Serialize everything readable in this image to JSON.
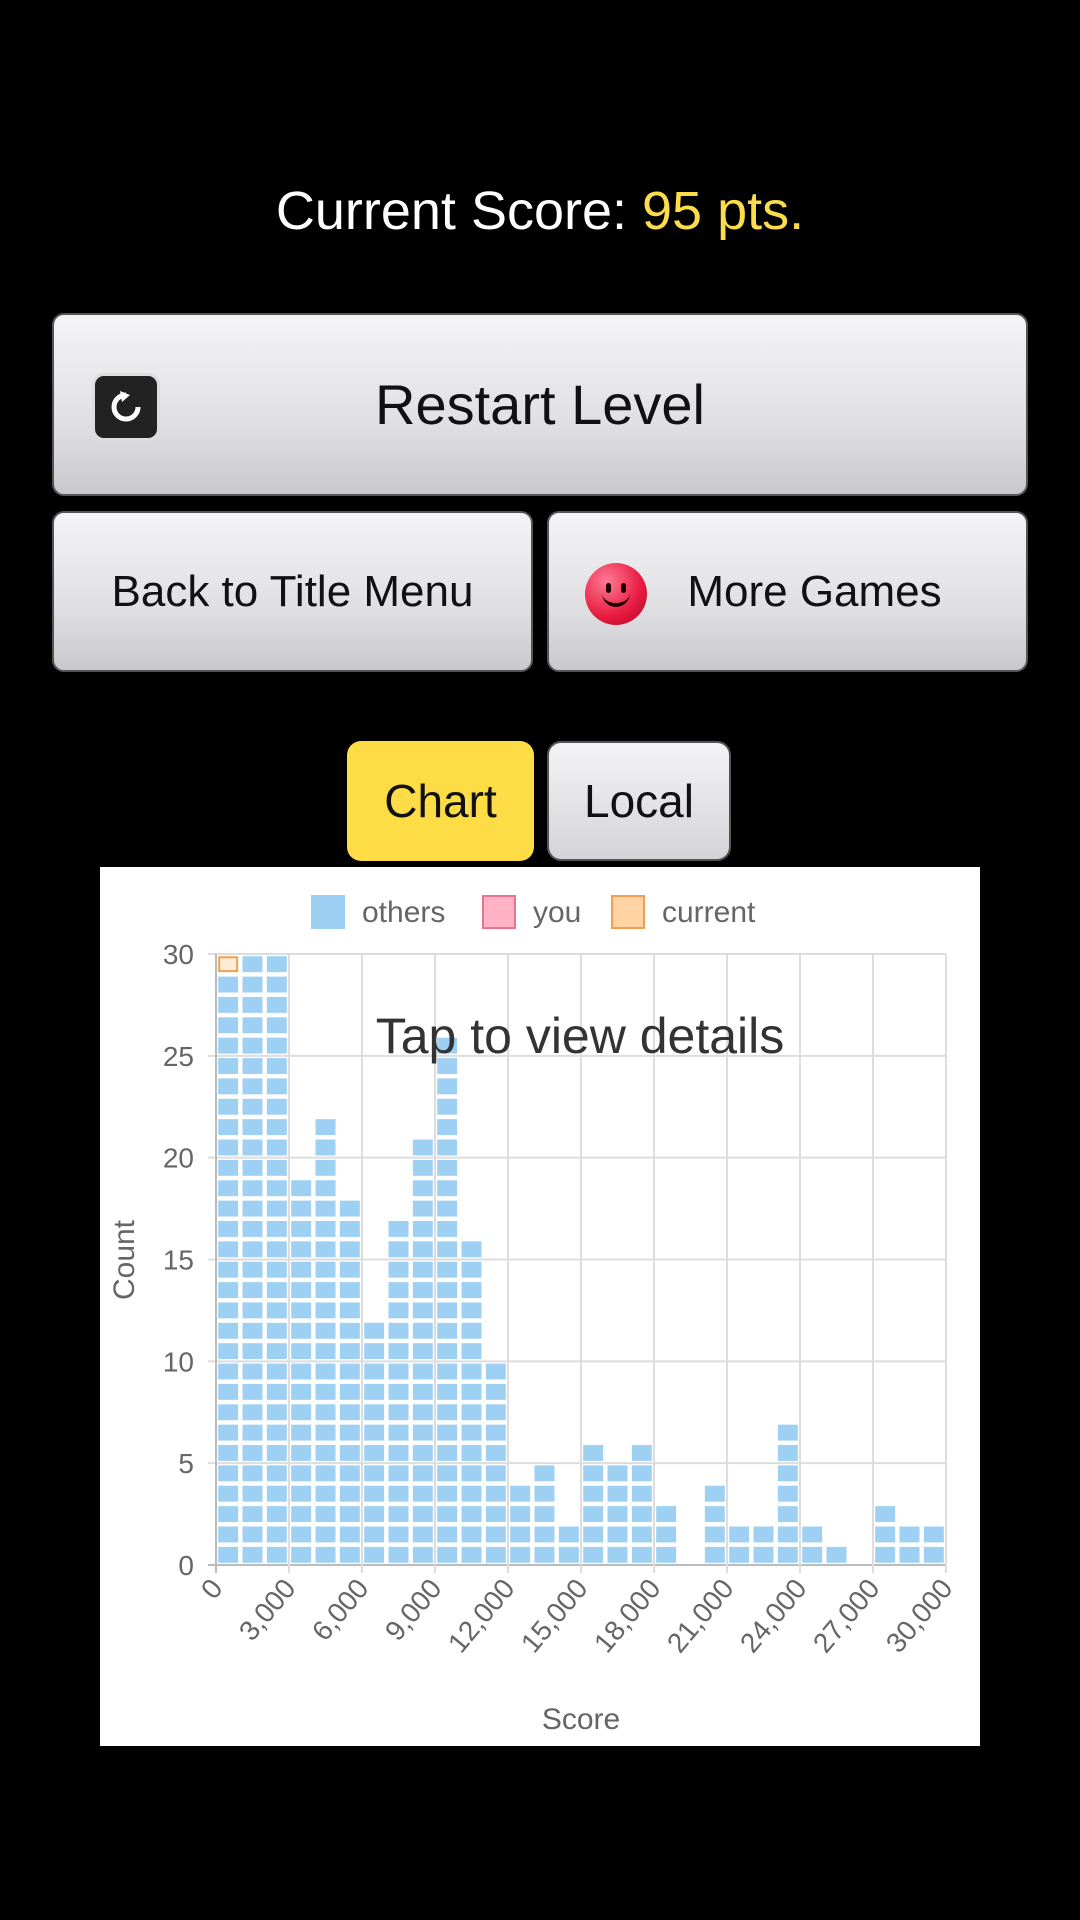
{
  "header": {
    "score_label": "Current Score: ",
    "score_value": "95 pts."
  },
  "buttons": {
    "restart": "Restart Level",
    "back_to_title": "Back to Title Menu",
    "more_games": "More Games"
  },
  "tabs": [
    {
      "label": "Chart",
      "active": true
    },
    {
      "label": "Local",
      "active": false
    }
  ],
  "colors": {
    "accent": "#fddc4b",
    "others": "#9dd0f3",
    "you": "#ffb3c4",
    "current": "#ffd3a3"
  },
  "chart_data": {
    "type": "bar",
    "title": "",
    "overlay_text": "Tap to view details",
    "xlabel": "Score",
    "ylabel": "Count",
    "xlim": [
      0,
      30000
    ],
    "ylim": [
      0,
      30
    ],
    "x_ticks": [
      "0",
      "3,000",
      "6,000",
      "9,000",
      "12,000",
      "15,000",
      "18,000",
      "21,000",
      "24,000",
      "27,000",
      "30,000"
    ],
    "y_ticks": [
      "0",
      "5",
      "10",
      "15",
      "20",
      "25",
      "30"
    ],
    "bin_width": 1000,
    "legend": [
      {
        "name": "others"
      },
      {
        "name": "you"
      },
      {
        "name": "current"
      }
    ],
    "legend_position": "top",
    "grid": true,
    "series": [
      {
        "name": "others",
        "bin_starts": [
          0,
          1000,
          2000,
          3000,
          4000,
          5000,
          6000,
          7000,
          8000,
          9000,
          10000,
          11000,
          12000,
          13000,
          14000,
          15000,
          16000,
          17000,
          18000,
          19000,
          20000,
          21000,
          22000,
          23000,
          24000,
          25000,
          26000,
          27000,
          28000,
          29000
        ],
        "values": [
          29,
          30,
          30,
          19,
          22,
          18,
          12,
          17,
          21,
          26,
          16,
          10,
          4,
          5,
          2,
          6,
          5,
          6,
          3,
          0,
          4,
          2,
          2,
          7,
          2,
          1,
          0,
          3,
          2,
          2
        ]
      },
      {
        "name": "current",
        "bin_starts": [
          0
        ],
        "values": [
          1
        ],
        "stacked_on": "others"
      }
    ]
  }
}
